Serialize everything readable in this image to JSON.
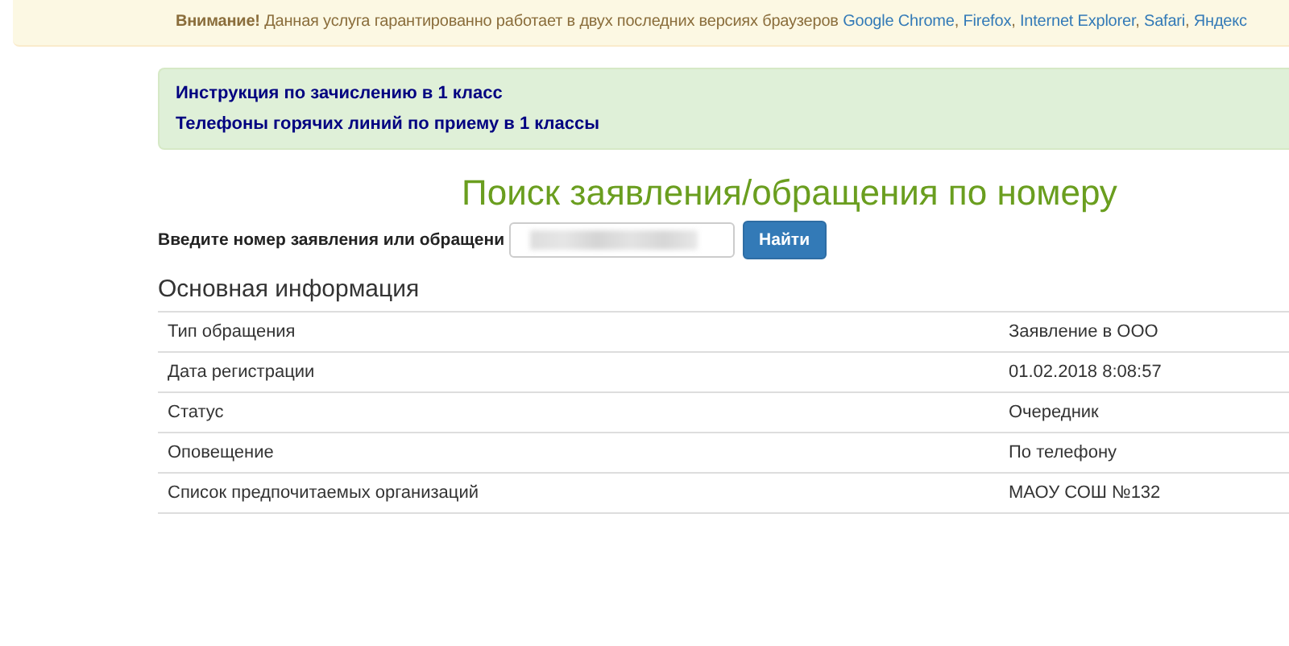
{
  "warning": {
    "lead": "**Внимание!** Данная услуга гарантированно работает в двух последних версиях браузеров",
    "links": [
      {
        "text": "Google Chrome",
        "sep": ","
      },
      {
        "text": "Firefox",
        "sep": ","
      },
      {
        "text": "Internet Explorer",
        "sep": ","
      },
      {
        "text": "Safari",
        "sep": ","
      },
      {
        "text": "Яндекс"
      }
    ]
  },
  "info_links": [
    "Инструкция по зачислению в 1 класс",
    "Телефоны горячих линий по приему в 1 классы"
  ],
  "search": {
    "title": "Поиск заявления/обращения по номеру",
    "label": "Введите номер заявления или обращени",
    "button": "Найти"
  },
  "details": {
    "heading": "Основная информация",
    "rows": [
      {
        "label": "Тип обращения",
        "value": "Заявление в ООО"
      },
      {
        "label": "Дата регистрации",
        "value": "01.02.2018 8:08:57"
      },
      {
        "label": "Статус",
        "value": "Очередник"
      },
      {
        "label": "Оповещение",
        "value": "По телефону"
      },
      {
        "label": "Список предпочитаемых организаций",
        "value": "МАОУ СОШ №132"
      }
    ]
  }
}
